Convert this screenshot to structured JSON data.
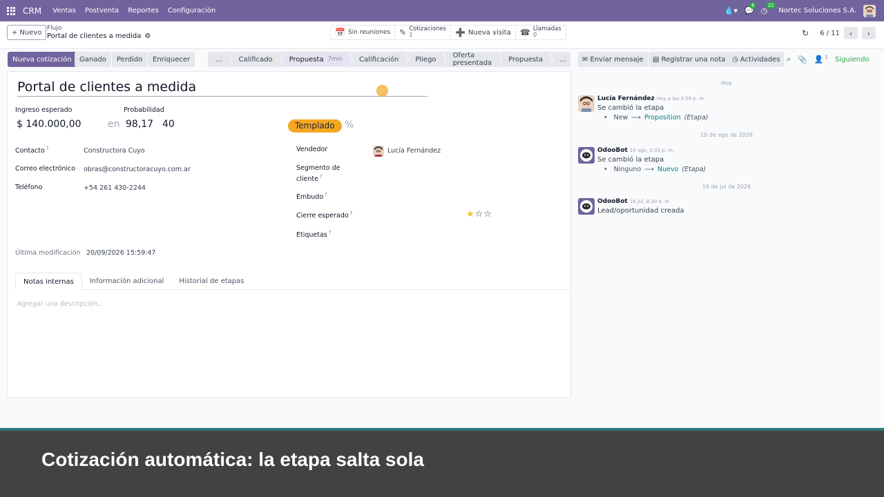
{
  "navbar": {
    "app_name": "CRM",
    "menu": [
      "Ventas",
      "Postventa",
      "Reportes",
      "Configuración"
    ],
    "messages_badge": "6",
    "activities_badge": "22",
    "company": "Nortec Soluciones S.A."
  },
  "control_panel": {
    "new_label": "Nuevo",
    "breadcrumb_parent": "Flujo",
    "breadcrumb_current": "Portal de clientes a medida",
    "smart_buttons": {
      "meetings": "Sin reuniones",
      "quotes_label": "Cotizaciones",
      "quotes_count": "1",
      "visit_label": "Nueva visita",
      "calls_label": "Llamadas",
      "calls_count": "0"
    },
    "pager": "6 / 11"
  },
  "statusbar": {
    "actions": [
      "Nueva cotización",
      "Ganado",
      "Perdido",
      "Enriquecer"
    ],
    "stages": [
      {
        "label": "...",
        "current": false
      },
      {
        "label": "Calificado",
        "current": false
      },
      {
        "label": "Propuesta",
        "current": true,
        "duration": "7min"
      },
      {
        "label": "Calificación",
        "current": false
      },
      {
        "label": "Pliego",
        "current": false
      },
      {
        "label": "Oferta presentada",
        "current": false
      },
      {
        "label": "Propuesta",
        "current": false
      },
      {
        "label": "...",
        "current": false
      }
    ]
  },
  "form": {
    "name": "Portal de clientes a medida",
    "expected_revenue_label": "Ingreso esperado",
    "expected_revenue": "$ 140.000,00",
    "probability_label": "Probabilidad",
    "probability_connector": "en",
    "probability_a": "98,17",
    "probability_b": "40",
    "tag_badge": "Templado",
    "percent_sign": "%",
    "contact_label": "Contacto",
    "contact": "Constructora Cuyo",
    "email_label": "Correo electrónico",
    "email": "obras@constructoracuyo.com.ar",
    "phone_label": "Teléfono",
    "phone": "+54 261 430-2244",
    "salesperson_label": "Vendedor",
    "salesperson": "Lucía Fernández",
    "segment_label_1": "Segmento de",
    "segment_label_2": "cliente",
    "funnel_label": "Embudo",
    "expected_close_label": "Cierre esperado",
    "priority_stars": 1,
    "priority_max": 3,
    "tags_label": "Etiquetas",
    "last_modified_label": "Última modificación",
    "last_modified": "20/09/2026 15:59:47",
    "tabs": [
      "Notas internas",
      "Información adicional",
      "Historial de etapas"
    ],
    "description_placeholder": "Agregar una descripción..."
  },
  "chatter": {
    "send_message": "Enviar mensaje",
    "log_note": "Registrar una nota",
    "activities": "Actividades",
    "followers_count": "1",
    "following": "Siguiendo",
    "separators": [
      "Hoy",
      "10 de ago de 2026",
      "16 de jul de 2026"
    ],
    "messages": [
      {
        "author": "Lucía Fernández",
        "time": "Hoy a las 3:59 p. m.",
        "body": "Se cambió la etapa",
        "from": "New",
        "to": "Proposition",
        "field": "(Etapa)"
      },
      {
        "author": "OdooBot",
        "time": "10 ago, 3:03 p. m.",
        "body": "Se cambió la etapa",
        "from": "Ninguno",
        "to": "Nuevo",
        "field": "(Etapa)"
      },
      {
        "author": "OdooBot",
        "time": "16 jul, 8:30 a. m.",
        "body": "Lead/oportunidad creada"
      }
    ]
  },
  "caption": "Cotización automática: la etapa salta sola",
  "colors": {
    "brand": "#71639e",
    "tag_badge": "#f5a623",
    "following": "#28a745",
    "caption_bg": "#424242"
  }
}
